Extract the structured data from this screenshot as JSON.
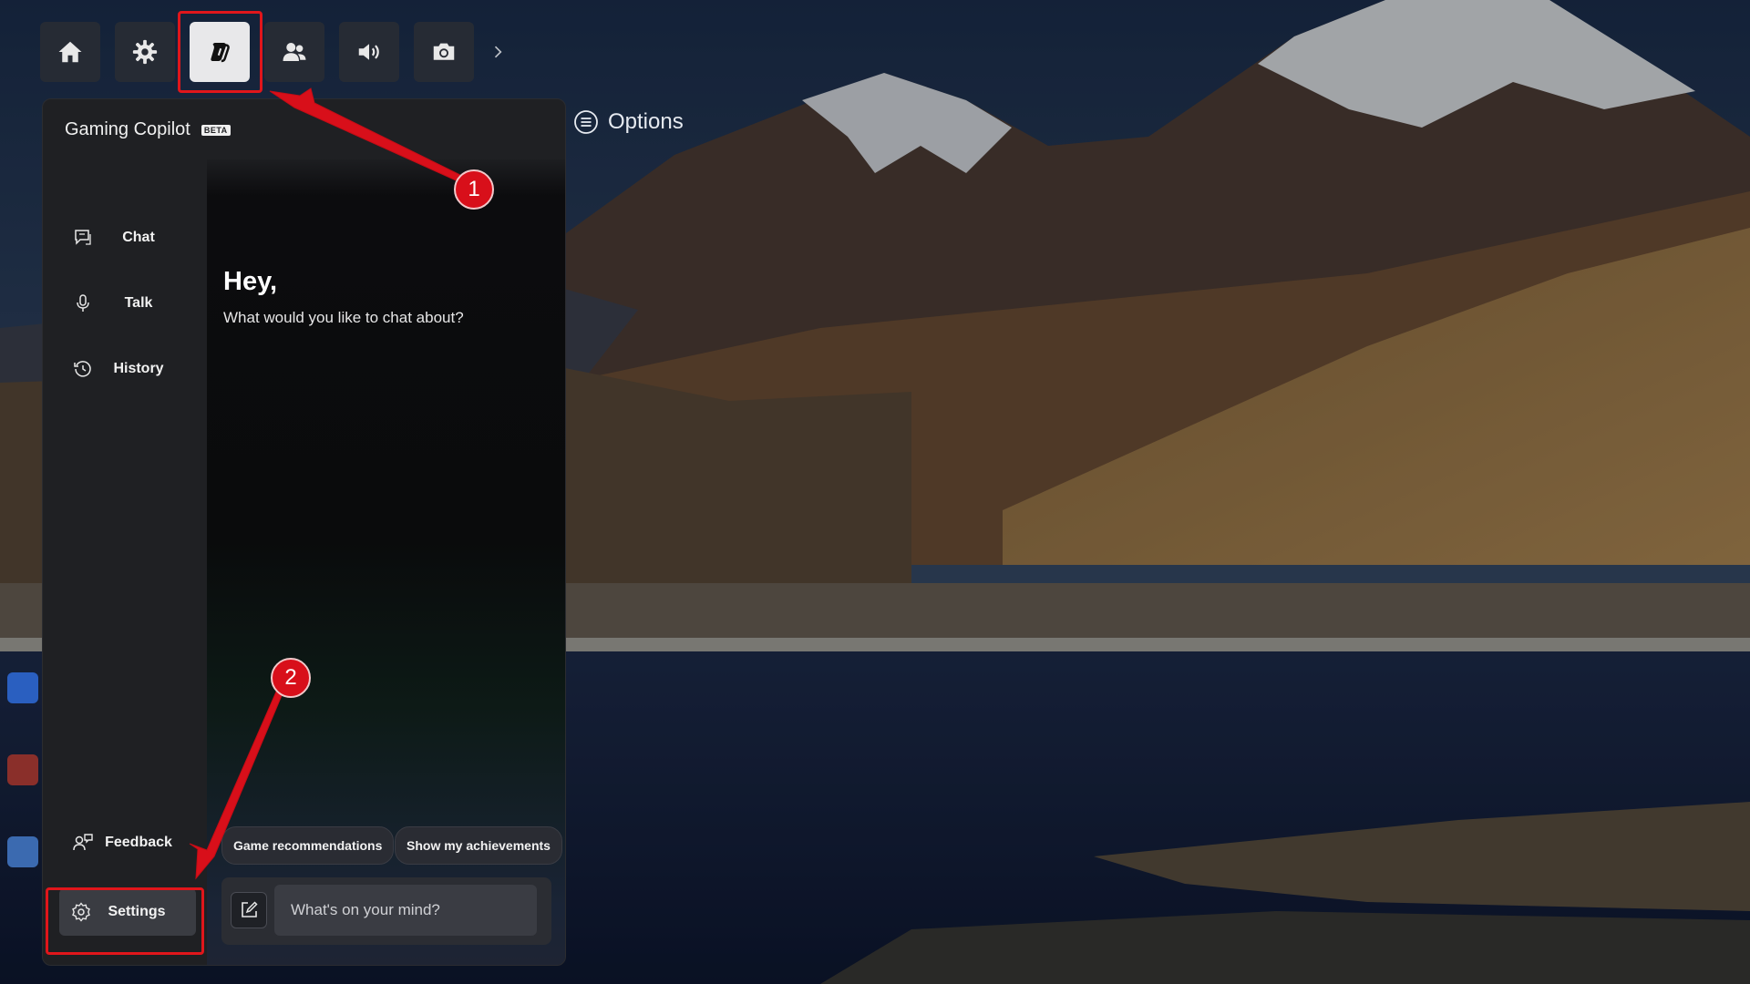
{
  "topbar": {
    "buttons": [
      {
        "icon": "home-icon",
        "active": false
      },
      {
        "icon": "gear-icon",
        "active": false
      },
      {
        "icon": "copilot-icon",
        "active": true
      },
      {
        "icon": "people-icon",
        "active": false
      },
      {
        "icon": "speaker-icon",
        "active": false
      },
      {
        "icon": "camera-icon",
        "active": false
      }
    ],
    "more_icon": "chevron-right-icon"
  },
  "options": {
    "label": "Options",
    "icon": "menu-circle-icon"
  },
  "panel": {
    "title": "Gaming Copilot",
    "badge": "BETA",
    "nav": [
      {
        "label": "Chat",
        "icon": "chat-icon"
      },
      {
        "label": "Talk",
        "icon": "microphone-icon"
      },
      {
        "label": "History",
        "icon": "history-icon"
      }
    ],
    "feedback_label": "Feedback",
    "settings_label": "Settings",
    "greeting": "Hey,",
    "greeting_sub": "What would you like to chat about?",
    "suggestions": [
      "Game recommendations",
      "Show my achievements"
    ],
    "composer": {
      "placeholder": "What's on your mind?"
    }
  },
  "annotations": {
    "step1": "1",
    "step2": "2",
    "color": "#e0161b"
  },
  "colors": {
    "panel_bg": "#1f2023",
    "accent_red": "#d80f1a",
    "active_button": "#e8e8ea"
  }
}
